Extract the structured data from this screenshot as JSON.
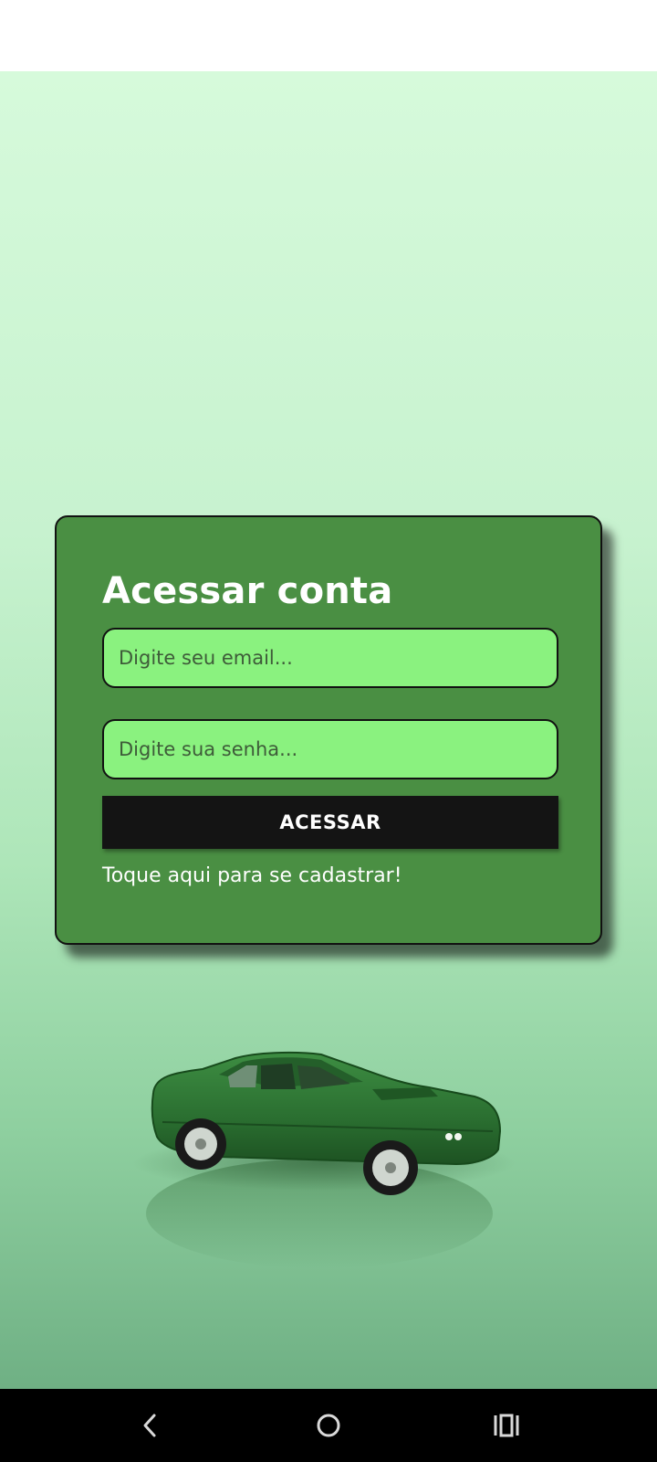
{
  "login": {
    "title": "Acessar conta",
    "email_placeholder": "Digite seu email...",
    "email_value": "",
    "password_placeholder": "Digite sua senha...",
    "password_value": "",
    "submit_label": "ACESSAR",
    "register_link": "Toque aqui para se cadastrar!"
  },
  "navigation": {
    "buttons": [
      "back-icon",
      "home-icon",
      "recents-icon"
    ]
  },
  "colors": {
    "background_top": "#d6fadb",
    "background_bottom": "#6fb084",
    "card": "#4a8f43",
    "input": "#8af27f",
    "button": "#141414",
    "car": "#2f7a34"
  },
  "illustration": {
    "subject": "green-muscle-car"
  }
}
